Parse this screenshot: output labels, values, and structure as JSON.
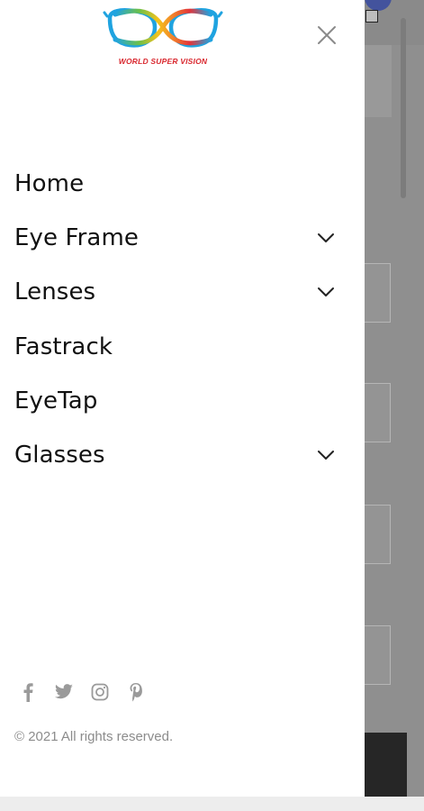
{
  "brand": {
    "logo_caption": "WORLD SUPER VISION",
    "logo_icon": "glasses-logo"
  },
  "drawer": {
    "close_icon": "close-icon",
    "menu": [
      {
        "label": "Home",
        "has_submenu": false
      },
      {
        "label": "Eye Frame",
        "has_submenu": true
      },
      {
        "label": "Lenses",
        "has_submenu": true
      },
      {
        "label": "Fastrack",
        "has_submenu": false
      },
      {
        "label": "EyeTap",
        "has_submenu": false
      },
      {
        "label": "Glasses",
        "has_submenu": true
      }
    ],
    "social": [
      {
        "icon": "facebook-icon"
      },
      {
        "icon": "twitter-icon"
      },
      {
        "icon": "instagram-icon"
      },
      {
        "icon": "pinterest-icon"
      }
    ],
    "copyright": "© 2021 All rights reserved."
  },
  "colors": {
    "drawer_bg": "#ffffff",
    "text": "#111111",
    "muted": "#8c8c8c",
    "overlay": "#8f8f8f",
    "logo_red": "#d9282f"
  }
}
